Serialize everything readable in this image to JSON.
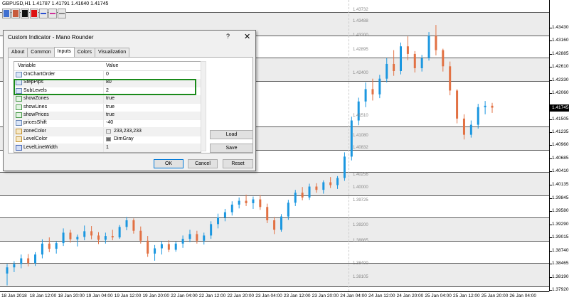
{
  "window": {
    "symbol_info": "GBPUSD,H1  1.41787 1.41791 1.41640 1.41745"
  },
  "toolbar": {
    "buttons": [
      {
        "name": "blue",
        "color": "#3f6fd0",
        "type": "fill"
      },
      {
        "name": "red",
        "color": "#c85a3c",
        "type": "fill"
      },
      {
        "name": "black",
        "color": "#111111",
        "type": "fill"
      },
      {
        "name": "red2",
        "color": "#dd1111",
        "type": "fill"
      },
      {
        "name": "blue-line",
        "color": "#2a4fd0",
        "type": "line"
      },
      {
        "name": "pink-line",
        "color": "#d0309a",
        "type": "line"
      },
      {
        "name": "gray-line",
        "color": "#888888",
        "type": "line"
      }
    ]
  },
  "colors": {
    "bull": "#1b97e0",
    "bear": "#e27143",
    "band": "#ececec",
    "band_edge": "#5a5a5a",
    "highlight": "#1a8a1a"
  },
  "chart_data": {
    "type": "candlestick",
    "symbol": "GBPUSD",
    "timeframe": "H1",
    "current_price": 1.41745,
    "y_range": [
      1.3796,
      1.4397
    ],
    "price_axis_labels": [
      "1.43430",
      "1.43160",
      "1.42885",
      "1.42610",
      "1.42330",
      "1.42060",
      "1.41745",
      "1.41505",
      "1.41235",
      "1.40960",
      "1.40685",
      "1.40410",
      "1.40135",
      "1.39845",
      "1.39580",
      "1.39290",
      "1.39015",
      "1.38740",
      "1.38465",
      "1.38190",
      "1.37920"
    ],
    "price_axis_values": [
      1.4343,
      1.4316,
      1.42885,
      1.4261,
      1.4233,
      1.4206,
      1.41745,
      1.41505,
      1.41235,
      1.4096,
      1.40685,
      1.4041,
      1.40135,
      1.39845,
      1.3958,
      1.3929,
      1.39015,
      1.3874,
      1.38465,
      1.3819,
      1.3792
    ],
    "time_labels": [
      "18 Jan 2018",
      "18 Jan 12:00",
      "18 Jan 20:00",
      "19 Jan 04:00",
      "19 Jan 12:00",
      "19 Jan 20:00",
      "22 Jan 04:00",
      "22 Jan 12:00",
      "22 Jan 20:00",
      "23 Jan 04:00",
      "23 Jan 12:00",
      "23 Jan 20:00",
      "24 Jan 04:00",
      "24 Jan 12:00",
      "24 Jan 20:00",
      "25 Jan 04:00",
      "25 Jan 12:00",
      "25 Jan 20:00",
      "26 Jan 04:00"
    ],
    "zone_bands": [
      {
        "top": 1.4376,
        "bottom": 1.4328
      },
      {
        "top": 1.428,
        "bottom": 1.4232
      },
      {
        "top": 1.4136,
        "bottom": 1.4088
      },
      {
        "top": 1.404,
        "bottom": 1.3992
      },
      {
        "top": 1.3944,
        "bottom": 1.3896
      },
      {
        "top": 1.3848,
        "bottom": 1.38
      }
    ],
    "level_labels": [
      "1.43732",
      "1.43488",
      "1.43200",
      "1.42895",
      "1.42400",
      "1.41510",
      "1.41080",
      "1.40832",
      "1.40256",
      "1.40000",
      "1.39725",
      "1.39200",
      "1.38865",
      "1.38400",
      "1.38105"
    ],
    "level_values": [
      1.43732,
      1.43488,
      1.432,
      1.42895,
      1.424,
      1.4151,
      1.4108,
      1.40832,
      1.40256,
      1.4,
      1.39725,
      1.392,
      1.38865,
      1.384,
      1.38105
    ],
    "candles": [
      [
        1.3826,
        1.3846,
        1.3801,
        1.3839
      ],
      [
        1.3839,
        1.3852,
        1.3829,
        1.3846
      ],
      [
        1.3846,
        1.3866,
        1.3837,
        1.3858
      ],
      [
        1.3858,
        1.3867,
        1.3841,
        1.3848
      ],
      [
        1.3848,
        1.3871,
        1.3842,
        1.3866
      ],
      [
        1.3866,
        1.3898,
        1.3858,
        1.3889
      ],
      [
        1.3889,
        1.3902,
        1.3871,
        1.3878
      ],
      [
        1.3878,
        1.3894,
        1.3868,
        1.389
      ],
      [
        1.389,
        1.3921,
        1.3884,
        1.3912
      ],
      [
        1.3912,
        1.3918,
        1.3891,
        1.3898
      ],
      [
        1.3898,
        1.3908,
        1.3883,
        1.3903
      ],
      [
        1.3903,
        1.3927,
        1.3896,
        1.3915
      ],
      [
        1.3915,
        1.3926,
        1.3898,
        1.3906
      ],
      [
        1.3906,
        1.3913,
        1.3888,
        1.3897
      ],
      [
        1.3897,
        1.3912,
        1.3889,
        1.3905
      ],
      [
        1.3905,
        1.3918,
        1.3896,
        1.3902
      ],
      [
        1.3902,
        1.3928,
        1.3899,
        1.3924
      ],
      [
        1.3924,
        1.3945,
        1.3917,
        1.3938
      ],
      [
        1.3938,
        1.3942,
        1.391,
        1.3916
      ],
      [
        1.3916,
        1.3925,
        1.3889,
        1.3895
      ],
      [
        1.3895,
        1.3905,
        1.3861,
        1.3868
      ],
      [
        1.3868,
        1.3886,
        1.3853,
        1.3879
      ],
      [
        1.3879,
        1.3894,
        1.3866,
        1.3888
      ],
      [
        1.3888,
        1.3896,
        1.3871,
        1.3876
      ],
      [
        1.3876,
        1.3893,
        1.3872,
        1.3889
      ],
      [
        1.3889,
        1.3906,
        1.388,
        1.3899
      ],
      [
        1.3899,
        1.3918,
        1.3892,
        1.3909
      ],
      [
        1.3909,
        1.3916,
        1.3889,
        1.3895
      ],
      [
        1.3895,
        1.3912,
        1.3887,
        1.3906
      ],
      [
        1.3906,
        1.3936,
        1.3899,
        1.393
      ],
      [
        1.393,
        1.3952,
        1.3921,
        1.3944
      ],
      [
        1.3944,
        1.3962,
        1.3936,
        1.3955
      ],
      [
        1.3955,
        1.3978,
        1.3948,
        1.3971
      ],
      [
        1.3971,
        1.3986,
        1.3963,
        1.3979
      ],
      [
        1.3979,
        1.3992,
        1.3968,
        1.3974
      ],
      [
        1.3974,
        1.3988,
        1.3962,
        1.3982
      ],
      [
        1.3982,
        1.3991,
        1.396,
        1.3966
      ],
      [
        1.3966,
        1.3973,
        1.3932,
        1.3938
      ],
      [
        1.3938,
        1.3945,
        1.3909,
        1.3918
      ],
      [
        1.3918,
        1.3951,
        1.3914,
        1.3946
      ],
      [
        1.3946,
        1.3981,
        1.3939,
        1.3975
      ],
      [
        1.3975,
        1.4002,
        1.3968,
        1.3996
      ],
      [
        1.3996,
        1.4008,
        1.398,
        1.3986
      ],
      [
        1.3986,
        1.4015,
        1.3981,
        1.4009
      ],
      [
        1.4009,
        1.4016,
        1.3996,
        1.4002
      ],
      [
        1.4002,
        1.4022,
        1.3994,
        1.4018
      ],
      [
        1.4018,
        1.4029,
        1.4006,
        1.4012
      ],
      [
        1.4012,
        1.4031,
        1.4004,
        1.4027
      ],
      [
        1.4027,
        1.4081,
        1.4021,
        1.4072
      ],
      [
        1.4072,
        1.4156,
        1.4064,
        1.4148
      ],
      [
        1.4148,
        1.4196,
        1.4138,
        1.4188
      ],
      [
        1.4188,
        1.4228,
        1.4176,
        1.4214
      ],
      [
        1.4214,
        1.4236,
        1.419,
        1.4203
      ],
      [
        1.4203,
        1.4244,
        1.4195,
        1.4236
      ],
      [
        1.4236,
        1.4279,
        1.4228,
        1.4267
      ],
      [
        1.4267,
        1.4296,
        1.4242,
        1.4252
      ],
      [
        1.4252,
        1.4312,
        1.4245,
        1.4304
      ],
      [
        1.4304,
        1.4325,
        1.4275,
        1.4288
      ],
      [
        1.4288,
        1.4294,
        1.4249,
        1.4258
      ],
      [
        1.4258,
        1.4286,
        1.4251,
        1.4279
      ],
      [
        1.4279,
        1.4334,
        1.4274,
        1.4326
      ],
      [
        1.4326,
        1.4349,
        1.4285,
        1.4296
      ],
      [
        1.4296,
        1.4299,
        1.4251,
        1.4262
      ],
      [
        1.4262,
        1.4272,
        1.4201,
        1.4211
      ],
      [
        1.4211,
        1.4214,
        1.4142,
        1.4152
      ],
      [
        1.4152,
        1.4161,
        1.4108,
        1.4118
      ],
      [
        1.4118,
        1.4148,
        1.4112,
        1.4139
      ],
      [
        1.4139,
        1.4183,
        1.4131,
        1.4176
      ],
      [
        1.4176,
        1.4189,
        1.4161,
        1.4179
      ],
      [
        1.4179,
        1.4185,
        1.4164,
        1.4175
      ]
    ]
  },
  "dialog": {
    "title": "Custom Indicator - Mano Rounder",
    "help": "?",
    "close": "✕",
    "tabs": [
      "About",
      "Common",
      "Inputs",
      "Colors",
      "Visualization"
    ],
    "active_tab": "Inputs",
    "grid": {
      "headers": {
        "variable": "Variable",
        "value": "Value"
      },
      "rows": [
        {
          "name": "OnChartOrder",
          "value": "0",
          "icon": "num"
        },
        {
          "name": "StepPips",
          "value": "80",
          "icon": "num"
        },
        {
          "name": "SubLevels",
          "value": "2",
          "icon": "num"
        },
        {
          "name": "showZones",
          "value": "true",
          "icon": "wave"
        },
        {
          "name": "showLines",
          "value": "true",
          "icon": "wave"
        },
        {
          "name": "showPrices",
          "value": "true",
          "icon": "wave"
        },
        {
          "name": "pricesShift",
          "value": "-40",
          "icon": "num"
        },
        {
          "name": "zoneColor",
          "value": "233,233,233",
          "icon": "pal",
          "swatch": "#e9e9e9"
        },
        {
          "name": "LevelColor",
          "value": "DimGray",
          "icon": "pal",
          "swatch": "#696969"
        },
        {
          "name": "LevelLineWidth",
          "value": "1",
          "icon": "wd"
        }
      ]
    },
    "buttons": {
      "load": "Load",
      "save": "Save",
      "ok": "OK",
      "cancel": "Cancel",
      "reset": "Reset"
    }
  }
}
